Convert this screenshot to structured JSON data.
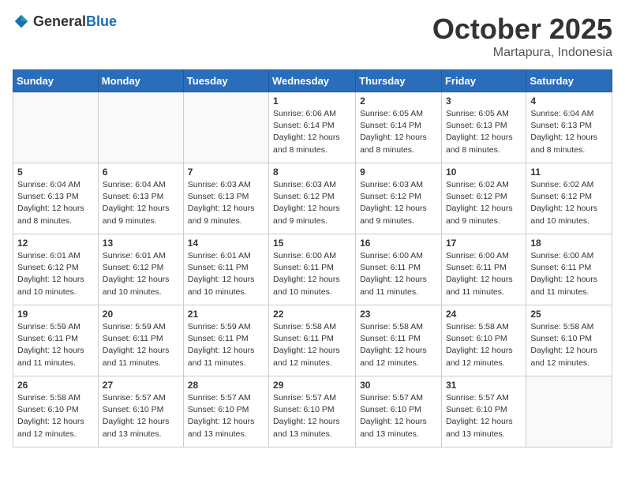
{
  "header": {
    "logo_general": "General",
    "logo_blue": "Blue",
    "month": "October 2025",
    "location": "Martapura, Indonesia"
  },
  "days_of_week": [
    "Sunday",
    "Monday",
    "Tuesday",
    "Wednesday",
    "Thursday",
    "Friday",
    "Saturday"
  ],
  "weeks": [
    [
      {
        "day": "",
        "info": ""
      },
      {
        "day": "",
        "info": ""
      },
      {
        "day": "",
        "info": ""
      },
      {
        "day": "1",
        "info": "Sunrise: 6:06 AM\nSunset: 6:14 PM\nDaylight: 12 hours\nand 8 minutes."
      },
      {
        "day": "2",
        "info": "Sunrise: 6:05 AM\nSunset: 6:14 PM\nDaylight: 12 hours\nand 8 minutes."
      },
      {
        "day": "3",
        "info": "Sunrise: 6:05 AM\nSunset: 6:13 PM\nDaylight: 12 hours\nand 8 minutes."
      },
      {
        "day": "4",
        "info": "Sunrise: 6:04 AM\nSunset: 6:13 PM\nDaylight: 12 hours\nand 8 minutes."
      }
    ],
    [
      {
        "day": "5",
        "info": "Sunrise: 6:04 AM\nSunset: 6:13 PM\nDaylight: 12 hours\nand 8 minutes."
      },
      {
        "day": "6",
        "info": "Sunrise: 6:04 AM\nSunset: 6:13 PM\nDaylight: 12 hours\nand 9 minutes."
      },
      {
        "day": "7",
        "info": "Sunrise: 6:03 AM\nSunset: 6:13 PM\nDaylight: 12 hours\nand 9 minutes."
      },
      {
        "day": "8",
        "info": "Sunrise: 6:03 AM\nSunset: 6:12 PM\nDaylight: 12 hours\nand 9 minutes."
      },
      {
        "day": "9",
        "info": "Sunrise: 6:03 AM\nSunset: 6:12 PM\nDaylight: 12 hours\nand 9 minutes."
      },
      {
        "day": "10",
        "info": "Sunrise: 6:02 AM\nSunset: 6:12 PM\nDaylight: 12 hours\nand 9 minutes."
      },
      {
        "day": "11",
        "info": "Sunrise: 6:02 AM\nSunset: 6:12 PM\nDaylight: 12 hours\nand 10 minutes."
      }
    ],
    [
      {
        "day": "12",
        "info": "Sunrise: 6:01 AM\nSunset: 6:12 PM\nDaylight: 12 hours\nand 10 minutes."
      },
      {
        "day": "13",
        "info": "Sunrise: 6:01 AM\nSunset: 6:12 PM\nDaylight: 12 hours\nand 10 minutes."
      },
      {
        "day": "14",
        "info": "Sunrise: 6:01 AM\nSunset: 6:11 PM\nDaylight: 12 hours\nand 10 minutes."
      },
      {
        "day": "15",
        "info": "Sunrise: 6:00 AM\nSunset: 6:11 PM\nDaylight: 12 hours\nand 10 minutes."
      },
      {
        "day": "16",
        "info": "Sunrise: 6:00 AM\nSunset: 6:11 PM\nDaylight: 12 hours\nand 11 minutes."
      },
      {
        "day": "17",
        "info": "Sunrise: 6:00 AM\nSunset: 6:11 PM\nDaylight: 12 hours\nand 11 minutes."
      },
      {
        "day": "18",
        "info": "Sunrise: 6:00 AM\nSunset: 6:11 PM\nDaylight: 12 hours\nand 11 minutes."
      }
    ],
    [
      {
        "day": "19",
        "info": "Sunrise: 5:59 AM\nSunset: 6:11 PM\nDaylight: 12 hours\nand 11 minutes."
      },
      {
        "day": "20",
        "info": "Sunrise: 5:59 AM\nSunset: 6:11 PM\nDaylight: 12 hours\nand 11 minutes."
      },
      {
        "day": "21",
        "info": "Sunrise: 5:59 AM\nSunset: 6:11 PM\nDaylight: 12 hours\nand 11 minutes."
      },
      {
        "day": "22",
        "info": "Sunrise: 5:58 AM\nSunset: 6:11 PM\nDaylight: 12 hours\nand 12 minutes."
      },
      {
        "day": "23",
        "info": "Sunrise: 5:58 AM\nSunset: 6:11 PM\nDaylight: 12 hours\nand 12 minutes."
      },
      {
        "day": "24",
        "info": "Sunrise: 5:58 AM\nSunset: 6:10 PM\nDaylight: 12 hours\nand 12 minutes."
      },
      {
        "day": "25",
        "info": "Sunrise: 5:58 AM\nSunset: 6:10 PM\nDaylight: 12 hours\nand 12 minutes."
      }
    ],
    [
      {
        "day": "26",
        "info": "Sunrise: 5:58 AM\nSunset: 6:10 PM\nDaylight: 12 hours\nand 12 minutes."
      },
      {
        "day": "27",
        "info": "Sunrise: 5:57 AM\nSunset: 6:10 PM\nDaylight: 12 hours\nand 13 minutes."
      },
      {
        "day": "28",
        "info": "Sunrise: 5:57 AM\nSunset: 6:10 PM\nDaylight: 12 hours\nand 13 minutes."
      },
      {
        "day": "29",
        "info": "Sunrise: 5:57 AM\nSunset: 6:10 PM\nDaylight: 12 hours\nand 13 minutes."
      },
      {
        "day": "30",
        "info": "Sunrise: 5:57 AM\nSunset: 6:10 PM\nDaylight: 12 hours\nand 13 minutes."
      },
      {
        "day": "31",
        "info": "Sunrise: 5:57 AM\nSunset: 6:10 PM\nDaylight: 12 hours\nand 13 minutes."
      },
      {
        "day": "",
        "info": ""
      }
    ]
  ]
}
